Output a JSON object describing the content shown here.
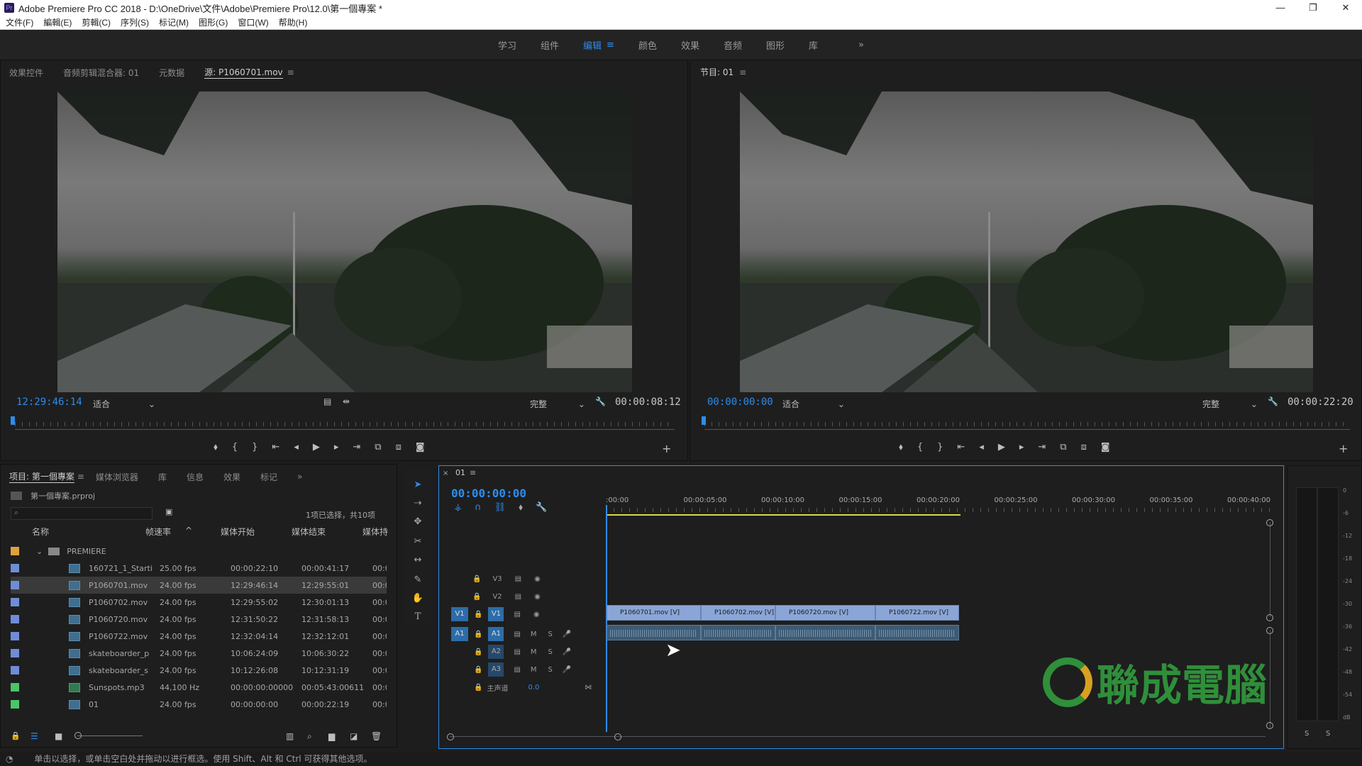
{
  "window": {
    "title": "Adobe Premiere Pro CC 2018 - D:\\OneDrive\\文件\\Adobe\\Premiere Pro\\12.0\\第一個專案 *",
    "app_icon": "Pr",
    "minimize": "—",
    "maximize": "❐",
    "close": "✕"
  },
  "menu": [
    "文件(F)",
    "編輯(E)",
    "剪輯(C)",
    "序列(S)",
    "标记(M)",
    "图形(G)",
    "窗口(W)",
    "帮助(H)"
  ],
  "workspaces": {
    "items": [
      "学习",
      "组件",
      "编辑",
      "颜色",
      "效果",
      "音频",
      "图形",
      "库"
    ],
    "active": "编辑",
    "more": "»"
  },
  "source_panel": {
    "tabs": [
      "效果控件",
      "音频剪辑混合器: 01",
      "元数据",
      "源: P1060701.mov"
    ],
    "active_tab": "源: P1060701.mov",
    "timecode": "12:29:46:14",
    "fit": "适合",
    "quality": "完整",
    "duration": "00:00:08:12"
  },
  "program_panel": {
    "tab": "节目: 01",
    "timecode": "00:00:00:00",
    "fit": "适合",
    "quality": "完整",
    "duration": "00:00:22:20"
  },
  "project_panel": {
    "tabs": [
      "项目: 第一個專案",
      "媒体浏览器",
      "库",
      "信息",
      "效果",
      "标记"
    ],
    "project_file": "第一個專案.prproj",
    "selection_info": "1项已选择，共10项",
    "columns": [
      "名称",
      "帧速率",
      "媒体开始",
      "媒体结束",
      "媒体持"
    ],
    "folder": "PREMIERE",
    "rows": [
      {
        "name": "160721_1_Starti",
        "fps": "25.00 fps",
        "start": "00:00:22:10",
        "end": "00:00:41:17",
        "dur": "00:0",
        "color": "#6f8cd6",
        "type": "video"
      },
      {
        "name": "P1060701.mov",
        "fps": "24.00 fps",
        "start": "12:29:46:14",
        "end": "12:29:55:01",
        "dur": "00:0",
        "color": "#6f8cd6",
        "type": "video"
      },
      {
        "name": "P1060702.mov",
        "fps": "24.00 fps",
        "start": "12:29:55:02",
        "end": "12:30:01:13",
        "dur": "00:0",
        "color": "#6f8cd6",
        "type": "video"
      },
      {
        "name": "P1060720.mov",
        "fps": "24.00 fps",
        "start": "12:31:50:22",
        "end": "12:31:58:13",
        "dur": "00:0",
        "color": "#6f8cd6",
        "type": "video"
      },
      {
        "name": "P1060722.mov",
        "fps": "24.00 fps",
        "start": "12:32:04:14",
        "end": "12:32:12:01",
        "dur": "00:0",
        "color": "#6f8cd6",
        "type": "video"
      },
      {
        "name": "skateboarder_p",
        "fps": "24.00 fps",
        "start": "10:06:24:09",
        "end": "10:06:30:22",
        "dur": "00:0",
        "color": "#6f8cd6",
        "type": "video"
      },
      {
        "name": "skateboarder_s",
        "fps": "24.00 fps",
        "start": "10:12:26:08",
        "end": "10:12:31:19",
        "dur": "00:0",
        "color": "#6f8cd6",
        "type": "video"
      },
      {
        "name": "Sunspots.mp3",
        "fps": "44,100 Hz",
        "start": "00:00:00:00000",
        "end": "00:05:43:00611",
        "dur": "00:0",
        "color": "#4bc46a",
        "type": "audio"
      },
      {
        "name": "01",
        "fps": "24.00 fps",
        "start": "00:00:00:00",
        "end": "00:00:22:19",
        "dur": "00:0",
        "color": "#4bc46a",
        "type": "sequence"
      }
    ]
  },
  "timeline": {
    "sequence_tab": "01",
    "timecode": "00:00:00:00",
    "ruler": [
      ":00:00",
      "00:00:05:00",
      "00:00:10:00",
      "00:00:15:00",
      "00:00:20:00",
      "00:00:25:00",
      "00:00:30:00",
      "00:00:35:00",
      "00:00:40:00"
    ],
    "video_tracks": [
      "V3",
      "V2",
      "V1"
    ],
    "audio_tracks": [
      "A1",
      "A2",
      "A3"
    ],
    "master_label": "主声道",
    "master_value": "0.0",
    "track_btn_m": "M",
    "track_btn_s": "S",
    "clips": [
      "P1060701.mov [V]",
      "P1060702.mov [V]",
      "P1060720.mov [V]",
      "P1060722.mov [V]"
    ]
  },
  "meter": {
    "scale": [
      "0",
      "-6",
      "-12",
      "-18",
      "-24",
      "-30",
      "-36",
      "-42",
      "-48",
      "-54",
      "dB"
    ],
    "solo": [
      "S",
      "S"
    ]
  },
  "watermark": "聯成電腦",
  "status_bar": "单击以选择，或单击空白处并拖动以进行框选。使用 Shift、Alt 和 Ctrl 可获得其他选项。"
}
